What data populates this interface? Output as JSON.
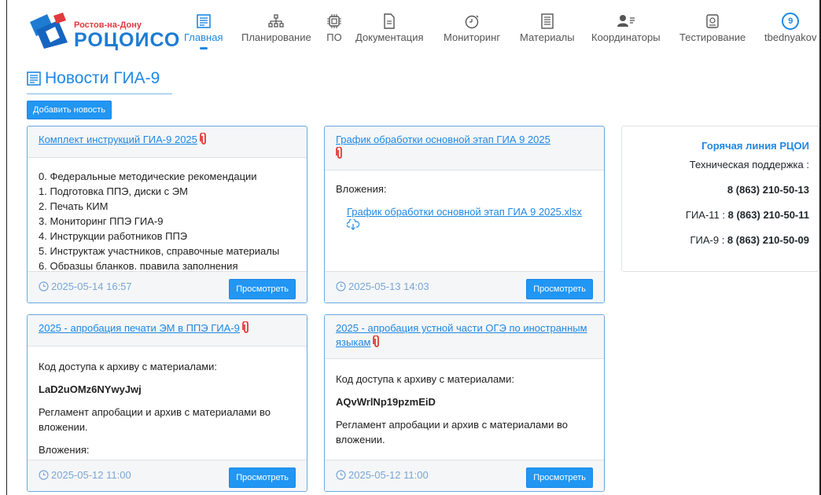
{
  "header": {
    "logo_city": "Ростов-на-Дону",
    "logo_brand": "РОЦОИСО",
    "nav": [
      {
        "label": "Главная",
        "icon": "news-icon",
        "active": true
      },
      {
        "label": "Планирование",
        "icon": "sitemap-icon"
      },
      {
        "label": "ПО",
        "icon": "chip-icon"
      },
      {
        "label": "Документация",
        "icon": "document-icon"
      },
      {
        "label": "Мониторинг",
        "icon": "stopwatch-icon"
      },
      {
        "label": "Материалы",
        "icon": "materials-icon"
      },
      {
        "label": "Координаторы",
        "icon": "users-icon"
      },
      {
        "label": "Тестирование",
        "icon": "test-icon"
      }
    ],
    "user": {
      "badge": "9",
      "name": "tbednyakov"
    }
  },
  "page": {
    "title": "Новости ГИА-9",
    "add_button": "Добавить новость"
  },
  "cards": [
    {
      "title": "Комплект инструкций ГИА-9 2025",
      "lines": [
        "0. Федеральные методические рекомендации",
        "1. Подготовка ППЭ, диски с ЭМ",
        "2. Печать КИМ",
        "3. Мониторинг ППЭ ГИА-9",
        "4. Инструкции работников ППЭ",
        "5. Инструктаж участников, справочные материалы",
        "6. Образцы бланков, правила заполнения"
      ],
      "date": "2025-05-14 16:57",
      "button": "Просмотреть"
    },
    {
      "title": "График обработки основной этап ГИА 9 2025",
      "attachments_label": "Вложения:",
      "attachment": "График обработки основной этап ГИА 9 2025.xlsx",
      "date": "2025-05-13 14:03",
      "button": "Просмотреть"
    },
    {
      "title": "2025 - апробация печати ЭМ в ППЭ ГИА-9",
      "code_label": "Код доступа к архиву с материалами:",
      "code": "LaD2uOMz6NYwyJwj",
      "text": "Регламент апробации и архив с материалами во вложении.",
      "attachments_label": "Вложения:",
      "date": "2025-05-12 11:00",
      "button": "Просмотреть"
    },
    {
      "title": "2025 - апробация устной части ОГЭ по иностранным языкам",
      "code_label": "Код доступа к архиву с материалами:",
      "code": "AQvWrlNp19pzmEiD",
      "text": "Регламент апробации и архив с материалами во вложении.",
      "date": "2025-05-12 11:00",
      "button": "Просмотреть"
    }
  ],
  "hotline": {
    "title": "Горячая линия РЦОИ",
    "support_label": "Техническая поддержка :",
    "support_phone": "8 (863) 210-50-13",
    "gia11_label": "ГИА-11 : ",
    "gia11_phone": "8 (863) 210-50-11",
    "gia9_label": "ГИА-9 : ",
    "gia9_phone": "8 (863) 210-50-09"
  },
  "colors": {
    "accent": "#1e88e5",
    "button": "#2196f3",
    "card_border": "#6aa8e2",
    "attachment": "#e53935",
    "date": "#7aa6d6"
  }
}
